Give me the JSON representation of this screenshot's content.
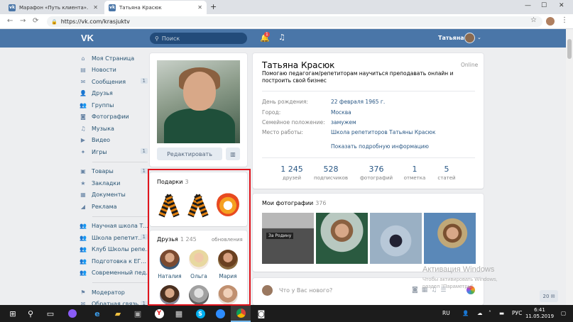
{
  "browser": {
    "tabs": [
      {
        "label": "Марафон «Путь клиента». Задан"
      },
      {
        "label": "Татьяна Красюк"
      }
    ],
    "url": "https://vk.com/krasjuktv",
    "favicon_letter": "vk"
  },
  "header": {
    "logo": "VK",
    "search_placeholder": "Поиск",
    "notif_count": "1",
    "user_name": "Татьяна"
  },
  "menu": {
    "group1": [
      {
        "icon": "home-icon",
        "glyph": "⌂",
        "label": "Моя Страница",
        "count": ""
      },
      {
        "icon": "news-icon",
        "glyph": "▤",
        "label": "Новости",
        "count": ""
      },
      {
        "icon": "messages-icon",
        "glyph": "✉",
        "label": "Сообщения",
        "count": "1"
      },
      {
        "icon": "friends-icon",
        "glyph": "👤",
        "label": "Друзья",
        "count": ""
      },
      {
        "icon": "groups-icon",
        "glyph": "👥",
        "label": "Группы",
        "count": ""
      },
      {
        "icon": "photos-icon",
        "glyph": "◙",
        "label": "Фотографии",
        "count": ""
      },
      {
        "icon": "music-icon",
        "glyph": "♫",
        "label": "Музыка",
        "count": ""
      },
      {
        "icon": "video-icon",
        "glyph": "▶",
        "label": "Видео",
        "count": ""
      },
      {
        "icon": "games-icon",
        "glyph": "✦",
        "label": "Игры",
        "count": "1"
      }
    ],
    "group2": [
      {
        "icon": "goods-icon",
        "glyph": "▣",
        "label": "Товары",
        "count": "1"
      },
      {
        "icon": "bookmarks-icon",
        "glyph": "★",
        "label": "Закладки",
        "count": ""
      },
      {
        "icon": "documents-icon",
        "glyph": "▦",
        "label": "Документы",
        "count": ""
      },
      {
        "icon": "ads-icon",
        "glyph": "◢",
        "label": "Реклама",
        "count": ""
      }
    ],
    "group3": [
      {
        "icon": "community-icon",
        "glyph": "👥",
        "label": "Научная школа Т...",
        "count": ""
      },
      {
        "icon": "community-icon",
        "glyph": "👥",
        "label": "Школа репетит...",
        "count": "1"
      },
      {
        "icon": "community-icon",
        "glyph": "👥",
        "label": "Клуб Школы репе...",
        "count": ""
      },
      {
        "icon": "community-icon",
        "glyph": "👥",
        "label": "Подготовка к ЕГ...",
        "count": ""
      },
      {
        "icon": "community-icon",
        "glyph": "👥",
        "label": "Современный пед...",
        "count": ""
      }
    ],
    "group4": [
      {
        "icon": "moderator-icon",
        "glyph": "⚑",
        "label": "Модератор",
        "count": ""
      },
      {
        "icon": "feedback-icon",
        "glyph": "✉",
        "label": "Обратная связь",
        "count": "1"
      }
    ]
  },
  "profile": {
    "edit_label": "Редактировать",
    "name": "Татьяна Красюк",
    "online": "Online",
    "status": "Помогаю педагогам/репетиторам научиться преподавать онлайн и построить свой бизнес",
    "fields": [
      {
        "label": "День рождения:",
        "value": "22 февраля 1965 г."
      },
      {
        "label": "Город:",
        "value": "Москва"
      },
      {
        "label": "Семейное положение:",
        "value": "замужем"
      },
      {
        "label": "Место работы:",
        "value": "Школа репетиторов Татьяны Красюк"
      }
    ],
    "more_info": "Показать подробную информацию",
    "counters": [
      {
        "n": "1 245",
        "l": "друзей"
      },
      {
        "n": "528",
        "l": "подписчиков"
      },
      {
        "n": "376",
        "l": "фотографий"
      },
      {
        "n": "1",
        "l": "отметка"
      },
      {
        "n": "5",
        "l": "статей"
      }
    ]
  },
  "gifts": {
    "title": "Подарки",
    "count": "3"
  },
  "friends": {
    "title": "Друзья",
    "count": "1 245",
    "updates": "обновления",
    "list": [
      {
        "name": "Наталия"
      },
      {
        "name": "Ольга"
      },
      {
        "name": "Мария"
      }
    ]
  },
  "my_photos": {
    "title": "Мои фотографии",
    "count": "376",
    "caption": "За Родину"
  },
  "post": {
    "placeholder": "Что у Вас нового?"
  },
  "watermark": {
    "line1": "Активация Windows",
    "line2": "Чтобы активировать Windows, перейдите в",
    "line3": "раздел \"Параметры\"."
  },
  "chat_count": "20",
  "taskbar": {
    "lang": "RU",
    "lang2": "РУС",
    "time": "6:41",
    "date": "11.05.2019"
  },
  "colors": {
    "vk_blue": "#4a76a8",
    "link": "#2a5885",
    "highlight": "#e0141c"
  }
}
